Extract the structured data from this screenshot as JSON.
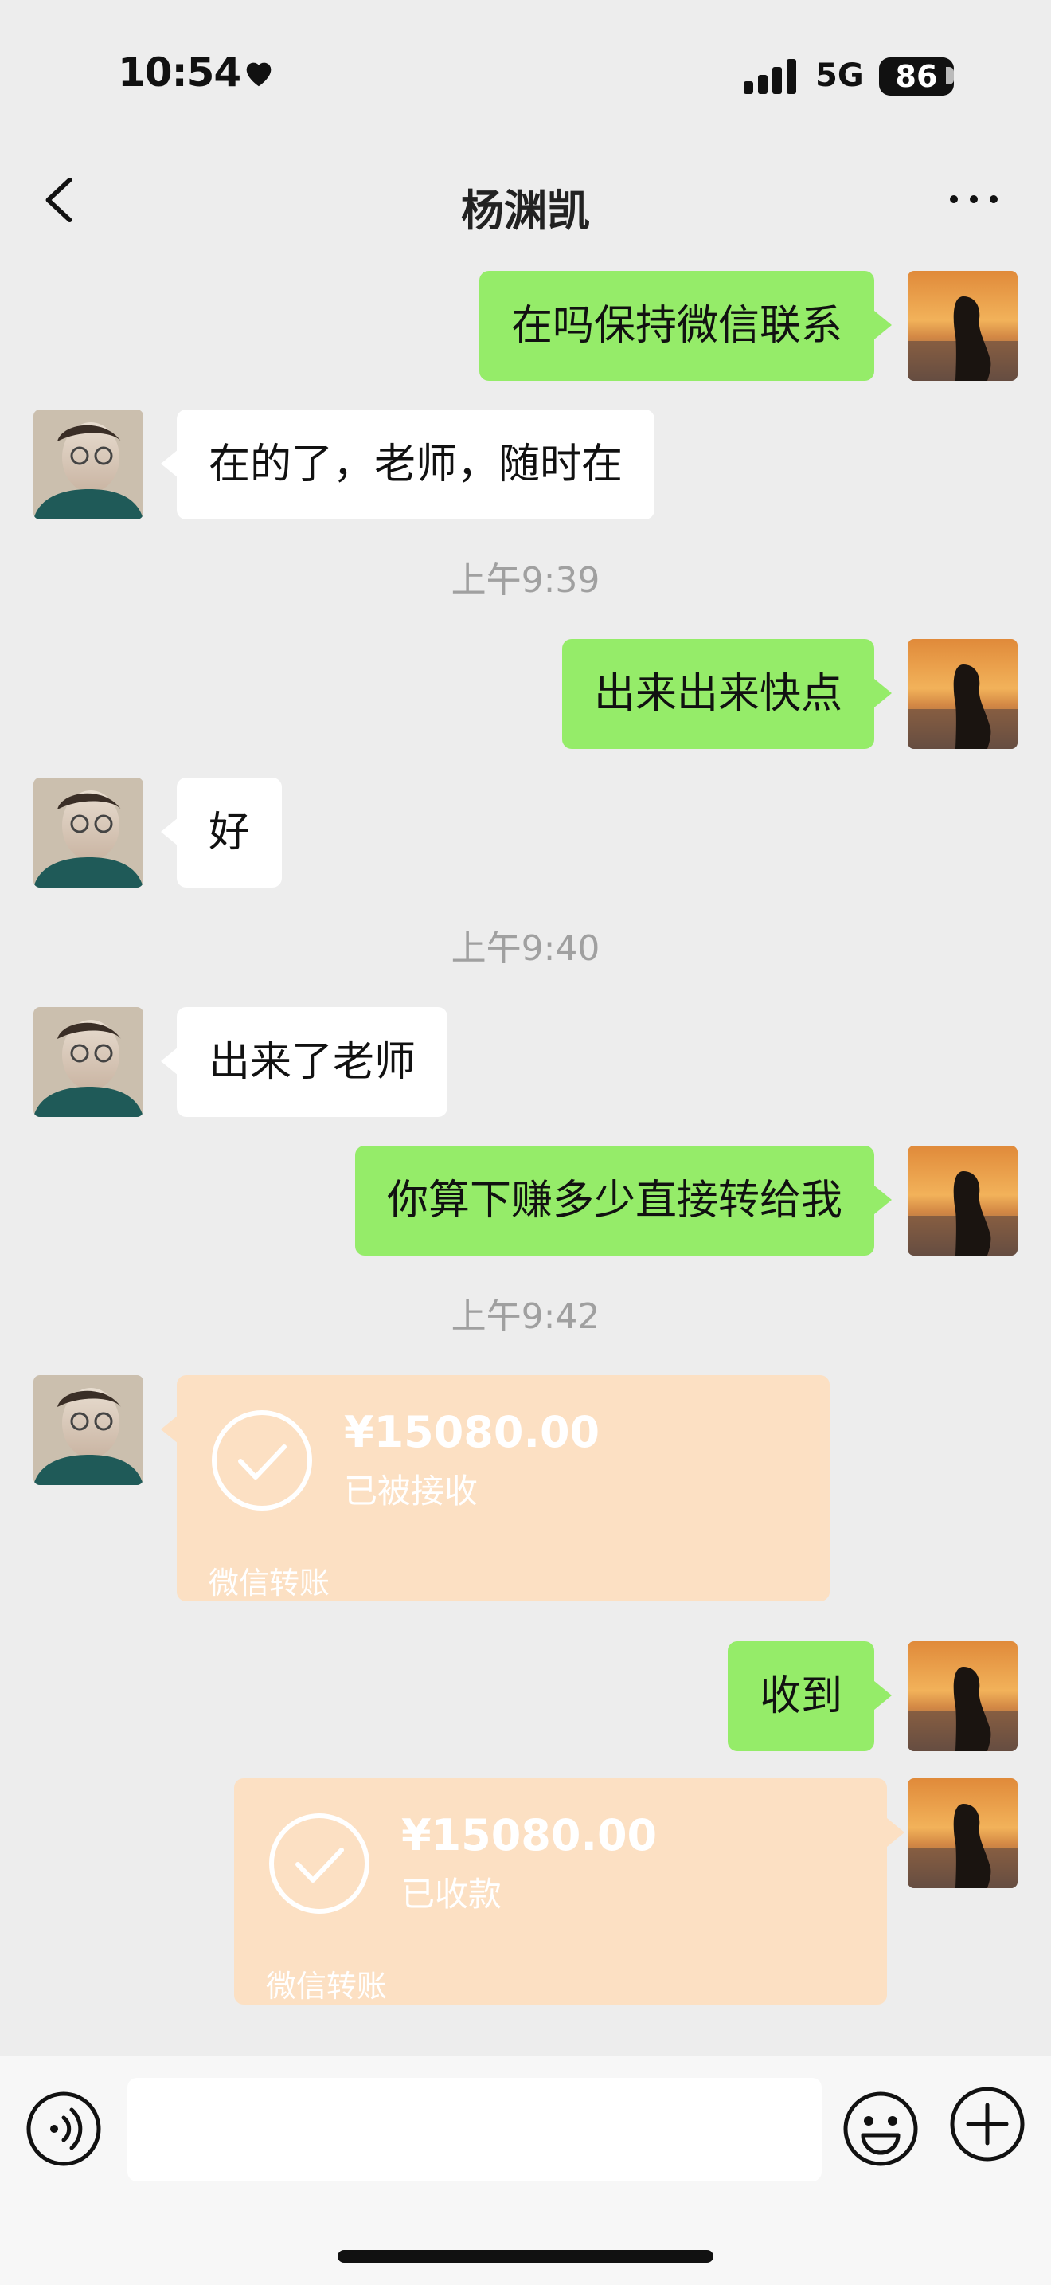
{
  "status_bar": {
    "time": "10:54",
    "network": "5G",
    "battery": "86"
  },
  "header": {
    "title": "杨渊凯"
  },
  "messages": [
    {
      "side": "right",
      "text": "在吗保持微信联系"
    },
    {
      "side": "left",
      "text": "在的了，老师，随时在"
    },
    {
      "time": "上午9:39"
    },
    {
      "side": "right",
      "text": "出来出来快点"
    },
    {
      "side": "left",
      "text": "好"
    },
    {
      "time": "上午9:40"
    },
    {
      "side": "left",
      "text": "出来了老师"
    },
    {
      "side": "right",
      "text": "你算下赚多少直接转给我"
    },
    {
      "time": "上午9:42"
    },
    {
      "side": "left",
      "transfer": {
        "amount": "¥15080.00",
        "status": "已被接收",
        "label": "微信转账"
      }
    },
    {
      "side": "right",
      "text": "收到"
    },
    {
      "side": "right",
      "transfer": {
        "amount": "¥15080.00",
        "status": "已收款",
        "label": "微信转账"
      }
    }
  ],
  "colors": {
    "background": "#ededed",
    "green_bubble": "#95ec69",
    "transfer_card": "#fce0c3"
  },
  "icons": [
    "heart-icon",
    "signal-icon",
    "back-icon",
    "more-icon",
    "check-circle-icon",
    "voice-icon",
    "emoji-icon",
    "plus-icon"
  ]
}
